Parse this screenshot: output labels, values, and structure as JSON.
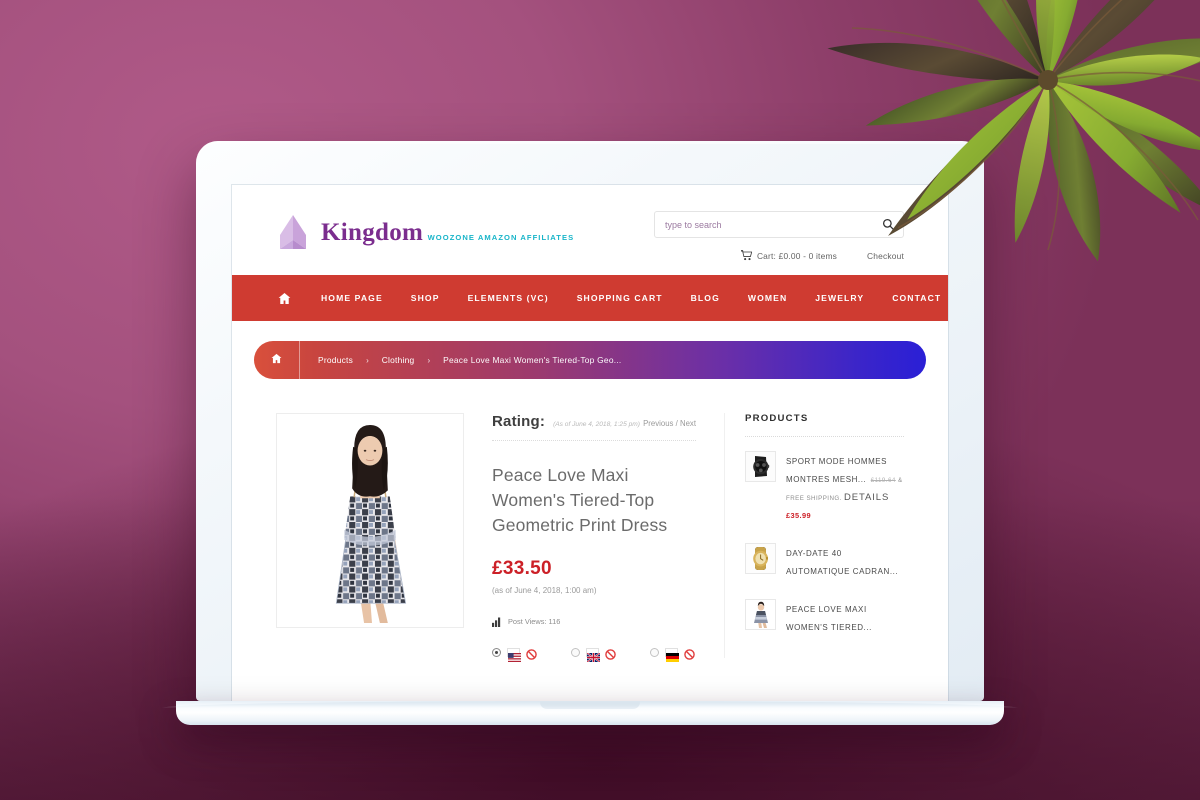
{
  "header": {
    "brand_name": "Kingdom",
    "brand_tagline": "WooZone Amazon Affiliates",
    "logo_icon": "crown-mark-icon",
    "search": {
      "placeholder": "type to search",
      "value": "",
      "icon": "search-icon"
    },
    "cart": {
      "icon": "cart-icon",
      "text": "Cart: £0.00 - 0 items"
    },
    "checkout_label": "Checkout"
  },
  "nav": {
    "home_icon": "home-icon",
    "items": [
      {
        "label": "Home Page"
      },
      {
        "label": "Shop"
      },
      {
        "label": "Elements (VC)"
      },
      {
        "label": "Shopping Cart"
      },
      {
        "label": "Blog"
      },
      {
        "label": "Women"
      },
      {
        "label": "Jewelry"
      },
      {
        "label": "Contact"
      }
    ]
  },
  "breadcrumb": {
    "home_icon": "home-icon",
    "separator": "›",
    "items": [
      {
        "label": "Products"
      },
      {
        "label": "Clothing"
      },
      {
        "label": "Peace Love Maxi Women's Tiered-Top Geo..."
      }
    ]
  },
  "product": {
    "image_alt": "woman wearing patchwork print tiered dress",
    "rating_label": "Rating:",
    "rating_asof": "(As of June 4, 2018, 1:25 pm)",
    "prev_label": "Previous",
    "prevnext_sep": "/",
    "next_label": "Next",
    "title": "Peace Love Maxi Women's Tiered-Top Geometric Print Dress",
    "price": "£33.50",
    "price_asof": "(as of June 4, 2018, 1:00 am)",
    "views_icon": "bar-chart-icon",
    "views_label": "Post Views: 116",
    "locales": [
      {
        "name": "united-states",
        "selected": true,
        "flag": "us",
        "blocked_icon": "no-entry-icon"
      },
      {
        "name": "united-kingdom",
        "selected": false,
        "flag": "uk",
        "blocked_icon": "no-entry-icon"
      },
      {
        "name": "germany",
        "selected": false,
        "flag": "de",
        "blocked_icon": "no-entry-icon"
      }
    ]
  },
  "sidebar": {
    "title": "Products",
    "items": [
      {
        "thumb": "black-chronograph-watch",
        "name": "Sport Mode Hommes Montres Mesh...",
        "old_price": "£119.64",
        "meta_suffix": "& Free Shipping.",
        "details_label": "Details",
        "price": "£35.99"
      },
      {
        "thumb": "gold-day-date-watch",
        "name": "Day-Date 40 Automatique Cadran...",
        "old_price": "",
        "meta_suffix": "",
        "details_label": "",
        "price": ""
      },
      {
        "thumb": "patchwork-print-dress",
        "name": "Peace Love Maxi Women's Tiered...",
        "old_price": "",
        "meta_suffix": "",
        "details_label": "",
        "price": ""
      }
    ]
  },
  "colors": {
    "brand_purple": "#7b2d8e",
    "brand_teal": "#18b5c9",
    "nav_red": "#cf3b31",
    "price_red": "#cc2027",
    "breadcrumb_start": "#d9503c",
    "breadcrumb_end": "#2a1fd6",
    "background_magenta": "#9e4a77"
  }
}
